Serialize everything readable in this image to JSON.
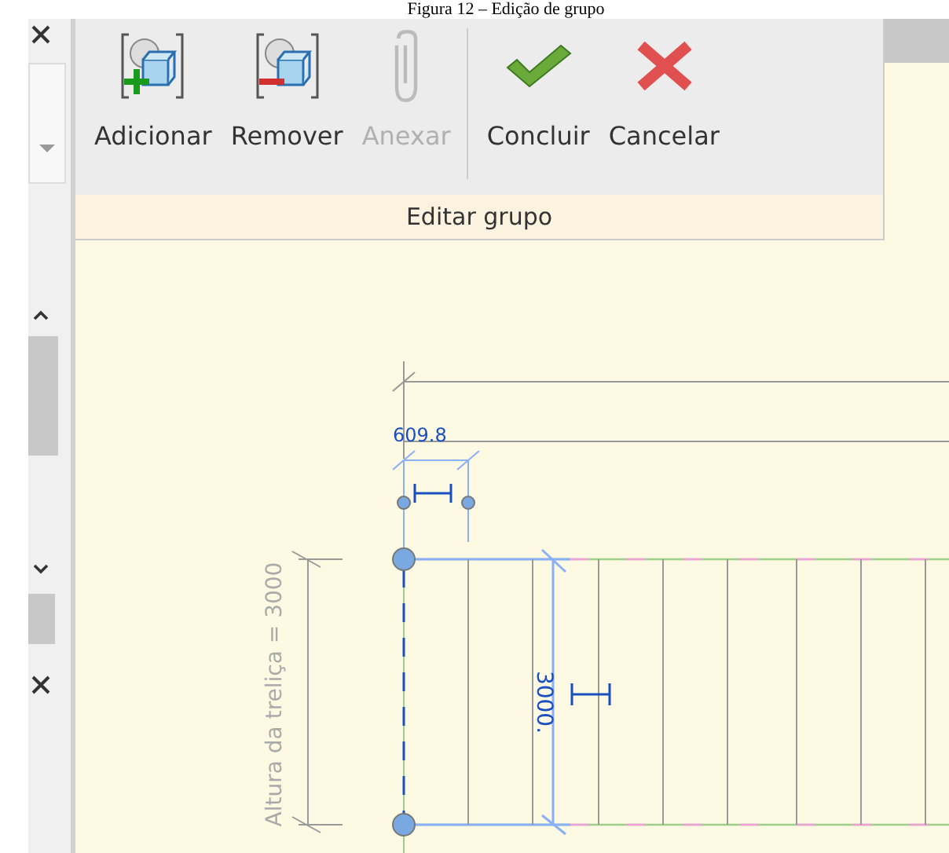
{
  "caption": "Figura 12 – Edição de grupo",
  "ribbon": {
    "groups": [
      {
        "buttons": [
          {
            "kind": "add",
            "label": "Adicionar",
            "disabled": false
          },
          {
            "kind": "remove",
            "label": "Remover",
            "disabled": false
          },
          {
            "kind": "attach",
            "label": "Anexar",
            "disabled": true
          }
        ]
      },
      {
        "buttons": [
          {
            "kind": "finish",
            "label": "Concluir",
            "disabled": false
          },
          {
            "kind": "cancel",
            "label": "Cancelar",
            "disabled": false
          }
        ]
      }
    ],
    "panel_title": "Editar grupo"
  },
  "drawing": {
    "width_dimension": "609.8",
    "height_dimension": "3000.",
    "height_label": "Altura da treliça = 3000"
  }
}
